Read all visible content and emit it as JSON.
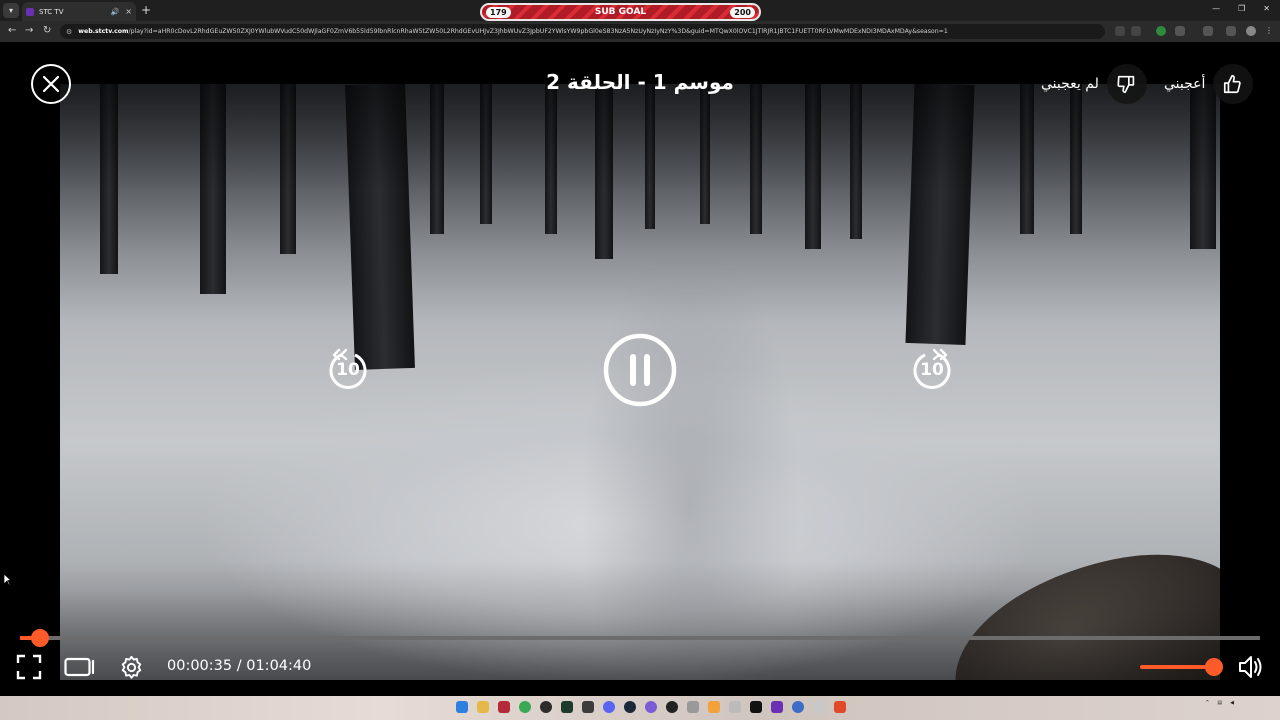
{
  "browser": {
    "tab_title": "STC TV",
    "url_domain": "web.stctv.com",
    "url_rest": "/play?id=aHR0cDovL2RhdGEuZW50ZXJ0YWlubWVudC50dWJlaGF0ZmV6b55ld59lbnRlcnRhaW5tZW50L2RhdGEvUHJvZ3JhbWUvZ3JpbUF2YWlsYW9pbGl0eS83NzA5NzUyNzIyNzY%3D&guid=MTQwX0lOVC1JTlRJR1JBTC1FUETT0RFLVMwMDExNDI3MDAxMDAy&season=1",
    "new_tab": "+",
    "tab_close": "×"
  },
  "overlay": {
    "subgoal_label": "SUB GOAL",
    "subgoal_current": "179",
    "subgoal_target": "200"
  },
  "player": {
    "title": "موسم 1 - الحلقة 2",
    "like_label": "أعجبني",
    "dislike_label": "لم يعجبني",
    "rewind_seconds": "10",
    "forward_seconds": "10",
    "current_time": "00:00:35",
    "time_separator": " / ",
    "duration": "01:04:40",
    "progress_fraction": 0.011,
    "volume_fraction": 1.0,
    "accent_color": "#ff5a2a"
  },
  "icons": {
    "close": "close-icon",
    "like": "thumbs-up-icon",
    "dislike": "thumbs-down-icon",
    "rewind": "rewind-10-icon",
    "pause": "pause-icon",
    "forward": "forward-10-icon",
    "fullscreen": "fullscreen-icon",
    "theater": "theater-mode-icon",
    "settings": "gear-icon",
    "volume": "volume-icon"
  }
}
